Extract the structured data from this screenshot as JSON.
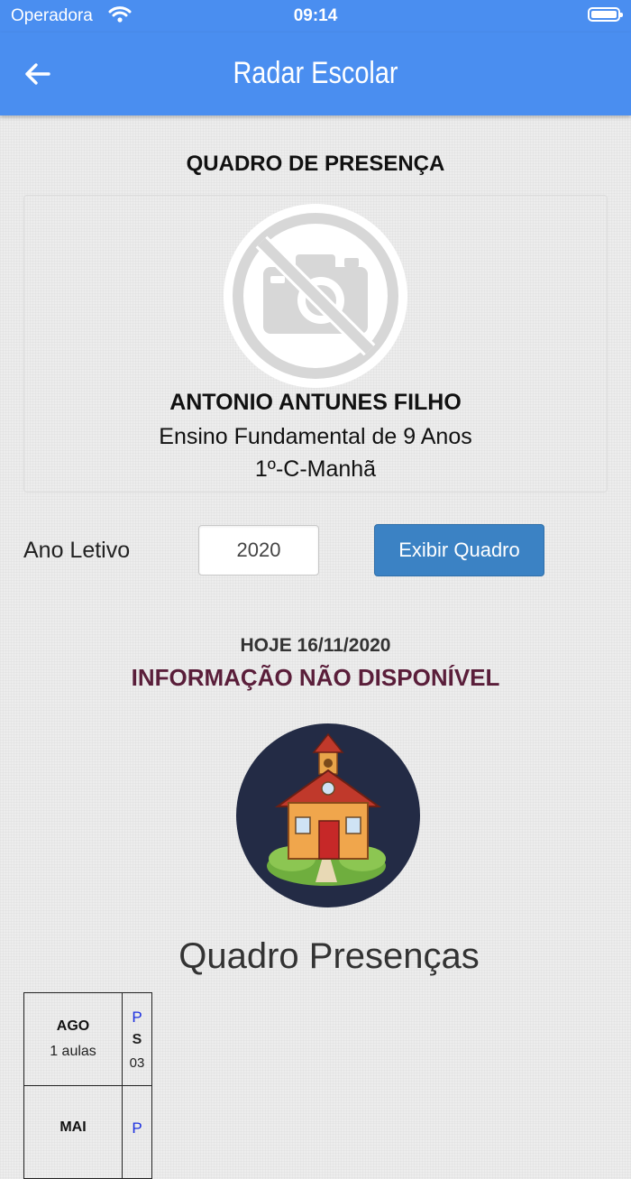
{
  "status_bar": {
    "carrier": "Operadora",
    "time": "09:14"
  },
  "nav": {
    "title": "Radar Escolar",
    "back_icon": "arrow-left-icon"
  },
  "page": {
    "heading": "QUADRO DE PRESENÇA"
  },
  "student": {
    "name": "ANTONIO ANTUNES FILHO",
    "course": "Ensino Fundamental de 9 Anos",
    "class": "1º-C-Manhã",
    "photo_icon": "no-photo-icon"
  },
  "form": {
    "year_label": "Ano Letivo",
    "year_value": "2020",
    "button_label": "Exibir Quadro"
  },
  "info": {
    "today": "HOJE 16/11/2020",
    "unavailable": "INFORMAÇÃO NÃO DISPONÍVEL"
  },
  "quadro": {
    "title": "Quadro Presenças",
    "rows": [
      {
        "month": "AGO",
        "classes": "1 aulas",
        "status": "P",
        "weekday": "S",
        "day": "03"
      },
      {
        "month": "MAI",
        "classes": "",
        "status": "P",
        "weekday": "",
        "day": ""
      }
    ]
  },
  "colors": {
    "primary": "#4a8ef0",
    "button": "#3b82c4",
    "unavailable_text": "#5a1e3a",
    "presence_mark": "#1a2ee0",
    "school_bg": "#232b45"
  }
}
